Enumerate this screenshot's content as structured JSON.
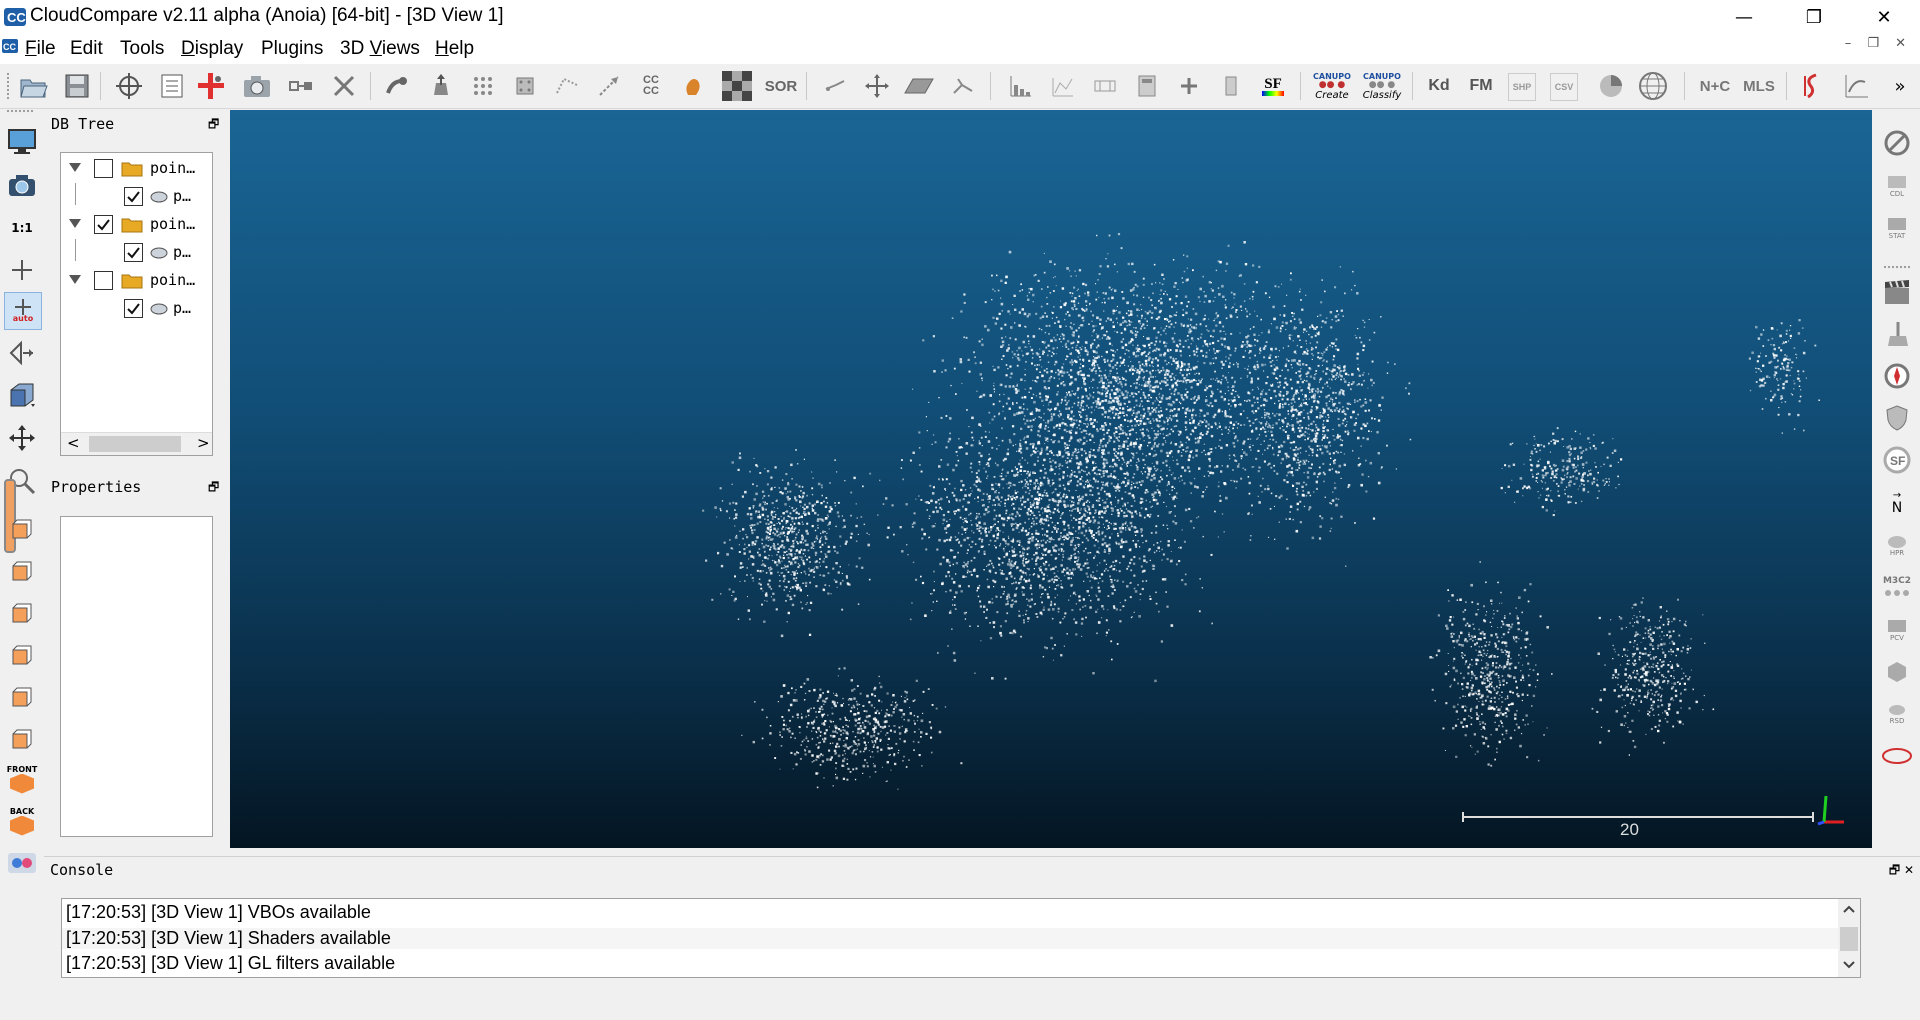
{
  "window": {
    "title": "CloudCompare v2.11 alpha (Anoia) [64-bit] - [3D View 1]",
    "minimize_glyph": "—",
    "maximize_glyph": "❐",
    "close_glyph": "✕"
  },
  "menu": {
    "items": [
      {
        "pre": "",
        "accel": "F",
        "post": "ile"
      },
      {
        "pre": "",
        "accel": "",
        "post": "Edit"
      },
      {
        "pre": "",
        "accel": "",
        "post": "Tools"
      },
      {
        "pre": "",
        "accel": "D",
        "post": "isplay"
      },
      {
        "pre": "",
        "accel": "",
        "post": "Plugins"
      },
      {
        "pre": "3D ",
        "accel": "V",
        "post": "iews"
      },
      {
        "pre": "",
        "accel": "H",
        "post": "elp"
      }
    ]
  },
  "toolbar": {
    "text_icons": {
      "cc": "CC\nCC",
      "sor": "SOR",
      "sf": "SF",
      "canupo_create_top": "CANUPO",
      "canupo_create_bottom": "Create",
      "canupo_classify_top": "CANUPO",
      "canupo_classify_bottom": "Classify",
      "kd": "Kd",
      "fm": "FM",
      "shp": "SHP",
      "csv": "CSV",
      "nc": "N+C",
      "mls": "MLS",
      "overflow": "»"
    }
  },
  "left_toolbar": {
    "one_to_one": "1:1",
    "auto": "auto",
    "front": "FRONT",
    "back": "BACK"
  },
  "db_tree": {
    "title": "DB Tree",
    "float_glyph": "🗗",
    "nodes": [
      {
        "label": "poin…",
        "checked": false,
        "child_label": "p…",
        "child_checked": true
      },
      {
        "label": "poin…",
        "checked": true,
        "child_label": "p…",
        "child_checked": true
      },
      {
        "label": "poin…",
        "checked": false,
        "child_label": "p…",
        "child_checked": true
      }
    ],
    "scroll_left": "<",
    "scroll_right": ">"
  },
  "properties": {
    "title": "Properties",
    "float_glyph": "🗗"
  },
  "view3d": {
    "scale_label": "20",
    "bg_top": "#1a6595",
    "bg_bottom": "#041522"
  },
  "right_toolbar": {
    "cdl": "CDL",
    "stat": "STAT",
    "north": "N",
    "hpr": "HPR",
    "m3c2": "M3C2",
    "pcv": "PCV",
    "rsd": "RSD"
  },
  "console": {
    "title": "Console",
    "controls": "🗗 ✕",
    "lines": [
      "[17:20:53] [3D View 1] VBOs available",
      "[17:20:53] [3D View 1] Shaders available",
      "[17:20:53] [3D View 1] GL filters available"
    ]
  }
}
